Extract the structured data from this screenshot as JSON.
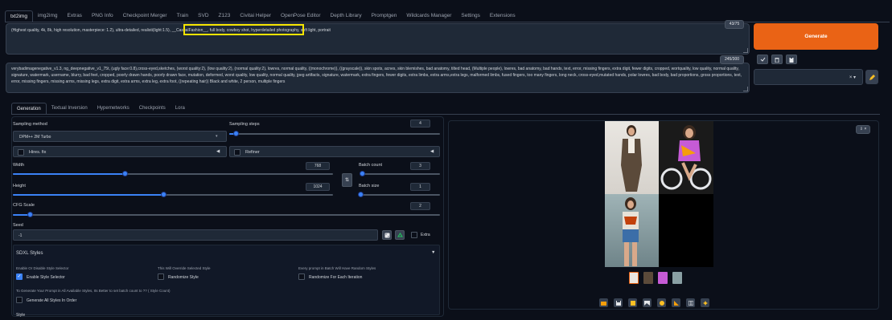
{
  "tabs": [
    "txt2img",
    "img2img",
    "Extras",
    "PNG Info",
    "Checkpoint Merger",
    "Train",
    "SVD",
    "Z123",
    "Civitai Helper",
    "OpenPose Editor",
    "Depth Library",
    "Promptgen",
    "Wildcards Manager",
    "Settings",
    "Extensions"
  ],
  "prompt": {
    "text_before": "(Highest quality, 4k, 8k, high resolution, masterpiece: 1.2), ultra-detailed, realisti",
    "text_highlight": "(light:1.5), __CasualFashion__, full body, cowboy shot,",
    "text_after": " hyperdetailed photography, soft light, portrait",
    "counter": "43/75"
  },
  "negative": {
    "text": "verybadimagenegative_v1.3, ng_deepnegative_v1_75t, (ugly face:0.8),cross-eyed,sketches, (worst quality:2), (low quality:2), (normal quality:2), lowres, normal quality, ((monochrome)), ((grayscale)), skin spots, acnes, skin blemishes, bad anatomy, tilted head, (Multiple people), lowres, bad anatomy, bad hands, text, error, missing fingers, extra digit, fewer digits, cropped, wortquality, low quality, normal quality, signature, watermark, username, blurry, bad feet, cropped, poorly drawn hands, poorly drawn face, mutation, deformed, worst quality, low quality, normal quality, jpeg artifacts, signature, watermark, extra fingers, fewer digits, extra limbs, extra arms,extra legs, malformed limbs, fused fingers, too many fingers, long neck, cross-eyed,mutated hands, polar lowres, bad body, bad proportions, gross proportions, text, error, missing fingers, missing arms, missing legs, extra digit, extra arms, extra leg, extra foot, ((repeating hair)) Black and white, 2 person, multiple fingers",
    "counter": "245/300"
  },
  "generate_label": "Generate",
  "tool_icons": [
    "check-icon",
    "trash-icon",
    "clipboard-icon"
  ],
  "style_clear": "× ▾",
  "subtabs": [
    "Generation",
    "Textual Inversion",
    "Hypernetworks",
    "Checkpoints",
    "Lora"
  ],
  "sampling_method": {
    "label": "Sampling method",
    "value": "DPM++ 2M Turbo"
  },
  "sampling_steps": {
    "label": "Sampling steps",
    "value": "4",
    "fraction": 0.03
  },
  "hires": {
    "label": "Hires. fix",
    "arrow": "◀"
  },
  "refiner": {
    "label": "Refiner",
    "arrow": "◀"
  },
  "width": {
    "label": "Width",
    "value": "768",
    "fraction": 0.35
  },
  "height": {
    "label": "Height",
    "value": "1024",
    "fraction": 0.47
  },
  "swap_icon": "⇅",
  "batch_count": {
    "label": "Batch count",
    "value": "3",
    "fraction": 0.02
  },
  "batch_size": {
    "label": "Batch size",
    "value": "1",
    "fraction": 0.0
  },
  "cfg": {
    "label": "CFG Scale",
    "value": "2",
    "fraction": 0.04
  },
  "seed": {
    "label": "Seed",
    "value": "-1",
    "extra": "Extra"
  },
  "sdxl": {
    "title": "SDXL Styles",
    "arrow": "▼",
    "enable_caption": "Enable Or Disable Style Selector",
    "enable_label": "Enable Style Selector",
    "override_caption": "This Will Override Selected Style",
    "randomize_label": "Randomize Style",
    "every_caption": "Every prompt in Batch Will Have Random Styles",
    "each_label": "Randomize For Each Iteration",
    "generate_caption": "To Generate Your Prompt in All Available Styles, Its Better to set batch count to ?? ( Style Count)",
    "generate_label": "Generate All Styles In Order",
    "style_label": "Style"
  },
  "output_corner": "⇩ ×",
  "colors": {
    "accent": "#ea6315",
    "slider": "#3b82f6",
    "highlight": "#f5e400"
  }
}
